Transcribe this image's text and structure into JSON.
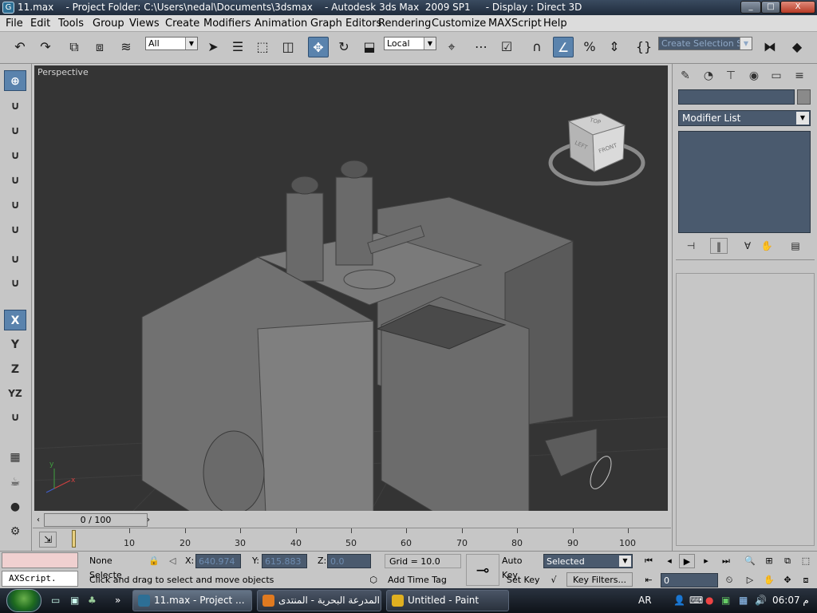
{
  "window": {
    "title": "11.max    - Project Folder: C:\\Users\\nedal\\Documents\\3dsmax    - Autodesk 3ds Max  2009 SP1     - Display : Direct 3D",
    "minimize": "_",
    "maximize": "□",
    "close": "X"
  },
  "menu": [
    "File",
    "Edit",
    "Tools",
    "Group",
    "Views",
    "Create",
    "Modifiers",
    "Animation",
    "Graph Editors",
    "Rendering",
    "Customize",
    "MAXScript",
    "Help"
  ],
  "toolbar": {
    "filter_value": "All",
    "coord_value": "Local",
    "named_selection_placeholder": "Create Selection Set"
  },
  "left_toolbar": {
    "axis_x": "X",
    "axis_y": "Y",
    "axis_z": "Z",
    "axis_yz": "YZ"
  },
  "viewport": {
    "label": "Perspective",
    "viewcube": {
      "top": "TOP",
      "left": "LEFT",
      "front": "FRONT"
    },
    "axis_x": "x",
    "axis_y": "y"
  },
  "command_panel": {
    "modifier_list": "Modifier List"
  },
  "timeline": {
    "frame_display": "0 / 100",
    "ticks": [
      "10",
      "20",
      "30",
      "40",
      "50",
      "60",
      "70",
      "80",
      "90",
      "100"
    ]
  },
  "status": {
    "maxscript_text": "AXScript.",
    "selection": "None Selecte",
    "x_label": "X:",
    "x_value": "640.974",
    "y_label": "Y:",
    "y_value": "615.883",
    "z_label": "Z:",
    "z_value": "0.0",
    "grid": "Grid = 10.0",
    "prompt": "Click and drag to select and move objects",
    "add_time_tag": "Add Time Tag",
    "auto_key": "Auto Key",
    "set_key": "Set Key",
    "selected_value": "Selected",
    "key_filters": "Key Filters...",
    "frame_value": "0"
  },
  "taskbar": {
    "tasks": [
      {
        "label": "11.max    - Project ...",
        "color": "#2d6f95"
      },
      {
        "label": "المدرعة البحرية - المنتدى...",
        "color": "#e07a20"
      },
      {
        "label": "Untitled - Paint",
        "color": "#e0b020"
      }
    ],
    "language": "AR",
    "clock": "06:07 م"
  }
}
